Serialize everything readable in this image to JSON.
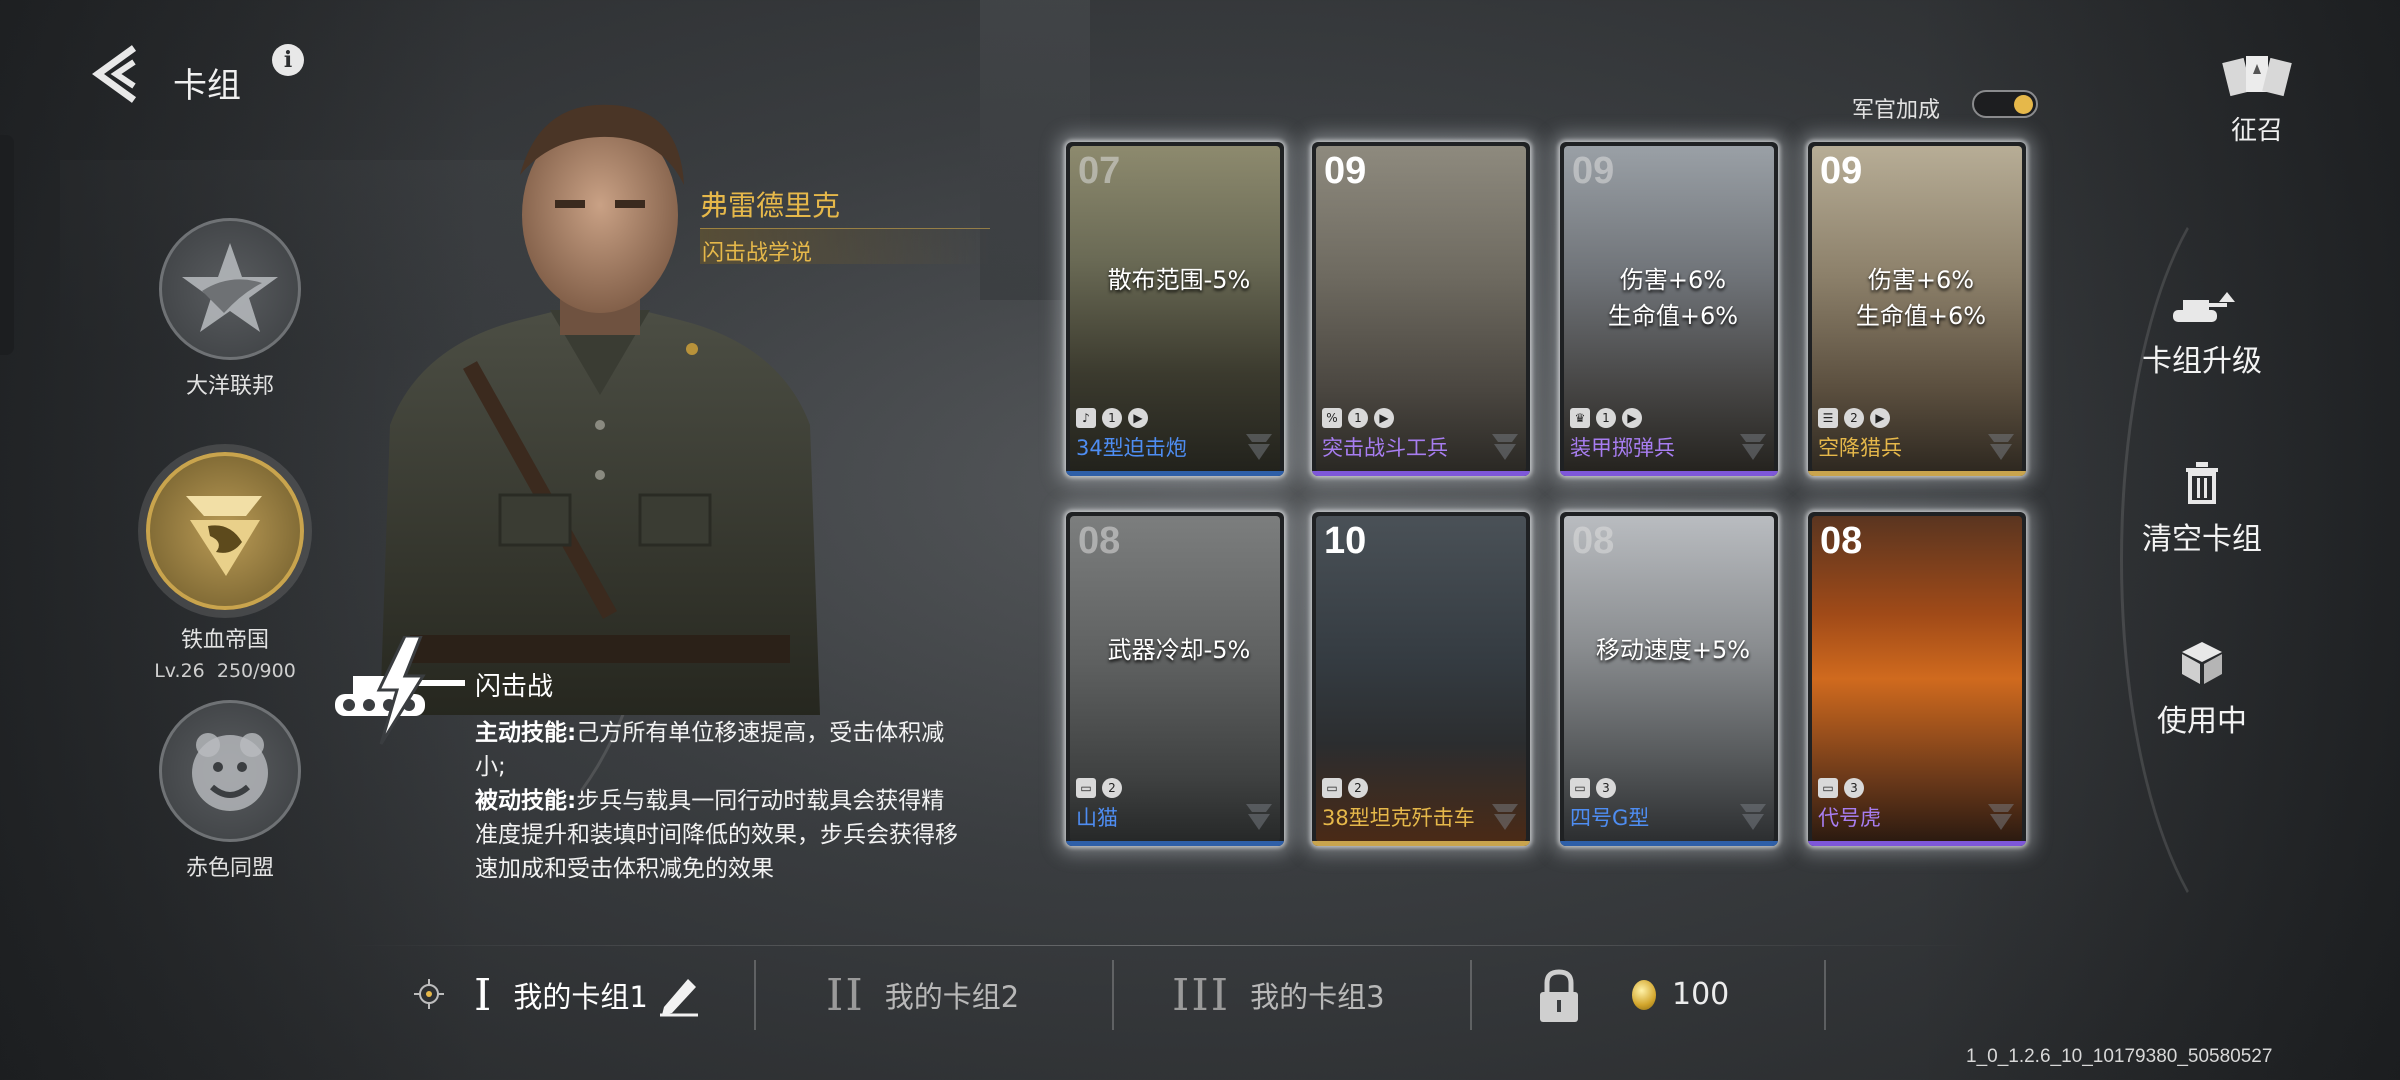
{
  "header": {
    "title": "卡组",
    "back": "back",
    "info": "i"
  },
  "factions": [
    {
      "name": "大洋联邦",
      "active": false
    },
    {
      "name": "铁血帝国",
      "active": true,
      "level": "Lv.26",
      "exp": "250/900"
    },
    {
      "name": "赤色同盟",
      "active": false
    }
  ],
  "commander": {
    "name": "弗雷德里克",
    "doctrine": "闪击战学说",
    "skill_name": "闪击战",
    "active_label": "主动技能:",
    "active_text": "己方所有单位移速提高，受击体积减小;",
    "passive_label": "被动技能:",
    "passive_text": "步兵与载具一同行动时载具会获得精准度提升和装填时间降低的效果，步兵会获得移速加成和受击体积减免的效果"
  },
  "officer_bonus": {
    "label": "军官加成",
    "on": true
  },
  "cards": [
    {
      "cost": "07",
      "bonus": [
        "散布范围-5%"
      ],
      "name": "34型迫击炮",
      "name_color": "#4e8df2",
      "rarity": "#2e5fa8",
      "tags": [
        "♪",
        "1",
        "▶"
      ]
    },
    {
      "cost": "09",
      "bonus": [],
      "name": "突击战斗工兵",
      "name_color": "#a77df0",
      "rarity": "#7e57d9",
      "tags": [
        "%",
        "1",
        "▶"
      ]
    },
    {
      "cost": "09",
      "bonus": [
        "伤害+6%",
        "生命值+6%"
      ],
      "name": "装甲掷弹兵",
      "name_color": "#a77df0",
      "rarity": "#7e57d9",
      "tags": [
        "♛",
        "1",
        "▶"
      ]
    },
    {
      "cost": "09",
      "bonus": [
        "伤害+6%",
        "生命值+6%"
      ],
      "name": "空降猎兵",
      "name_color": "#e6b84a",
      "rarity": "#c9a44d",
      "tags": [
        "☰",
        "2",
        "▶"
      ]
    },
    {
      "cost": "08",
      "bonus": [
        "武器冷却-5%"
      ],
      "name": "山猫",
      "name_color": "#4e8df2",
      "rarity": "#2e5fa8",
      "tags": [
        "▭",
        "2"
      ]
    },
    {
      "cost": "10",
      "bonus": [],
      "name": "38型坦克歼击车",
      "name_color": "#e6b84a",
      "rarity": "#c9a44d",
      "tags": [
        "▭",
        "2"
      ]
    },
    {
      "cost": "08",
      "bonus": [
        "移动速度+5%"
      ],
      "name": "四号G型",
      "name_color": "#4e8df2",
      "rarity": "#2e5fa8",
      "tags": [
        "▭",
        "3"
      ]
    },
    {
      "cost": "08",
      "bonus": [],
      "name": "代号虎",
      "name_color": "#a77df0",
      "rarity": "#7e57d9",
      "tags": [
        "▭",
        "3"
      ]
    }
  ],
  "right_rail": {
    "recruit": "征召",
    "upgrade": "卡组升级",
    "clear": "清空卡组",
    "in_use": "使用中"
  },
  "decks": [
    {
      "roman": "I",
      "label": "我的卡组1",
      "active": true
    },
    {
      "roman": "II",
      "label": "我的卡组2",
      "active": false
    },
    {
      "roman": "III",
      "label": "我的卡组3",
      "active": false
    }
  ],
  "unlock_cost": "100",
  "version": "1_0_1.2.6_10_10179380_50580527"
}
